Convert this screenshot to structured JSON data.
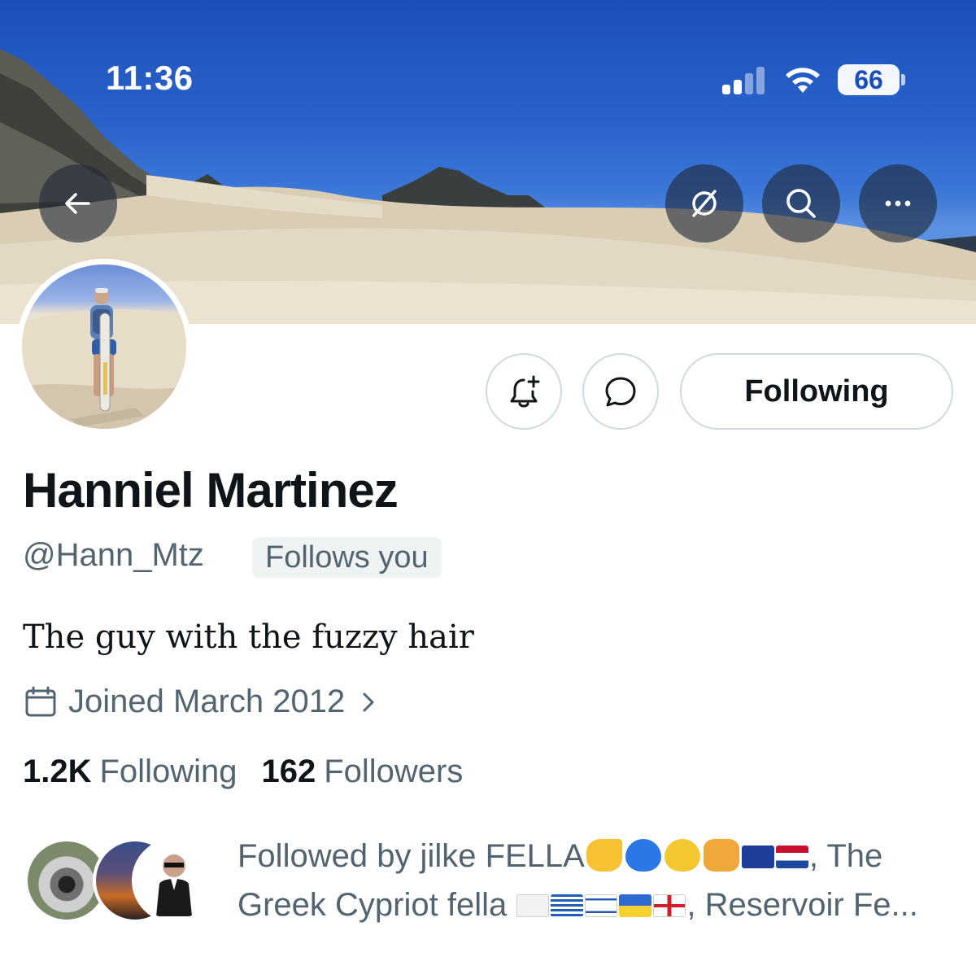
{
  "status_bar": {
    "time": "11:36",
    "battery": "66"
  },
  "profile": {
    "display_name": "Hanniel Martinez",
    "handle": "@Hann_Mtz",
    "follows_you_badge": "Follows you",
    "bio": "The guy with the fuzzy hair",
    "joined": "Joined March 2012",
    "following_count": "1.2K",
    "following_label": "Following",
    "followers_count": "162",
    "followers_label": "Followers"
  },
  "actions": {
    "following_button": "Following"
  },
  "followed_by": {
    "prefix": "Followed by jilke FELLA",
    "sep1": ", The",
    "line2": "Greek Cypriot fella",
    "suffix": ", Reservoir Fe..."
  },
  "icons": {
    "back": "arrow-left-icon",
    "grok": "slash-circle-icon",
    "search": "search-icon",
    "more": "more-dots-icon",
    "notify": "bell-plus-icon",
    "message": "chat-bubble-icon",
    "calendar": "calendar-icon",
    "chevron": "chevron-right-icon"
  },
  "colors": {
    "text": "#0f1419",
    "secondary": "#536471",
    "border": "#cfd9de",
    "badge_bg": "#eff3f4"
  }
}
